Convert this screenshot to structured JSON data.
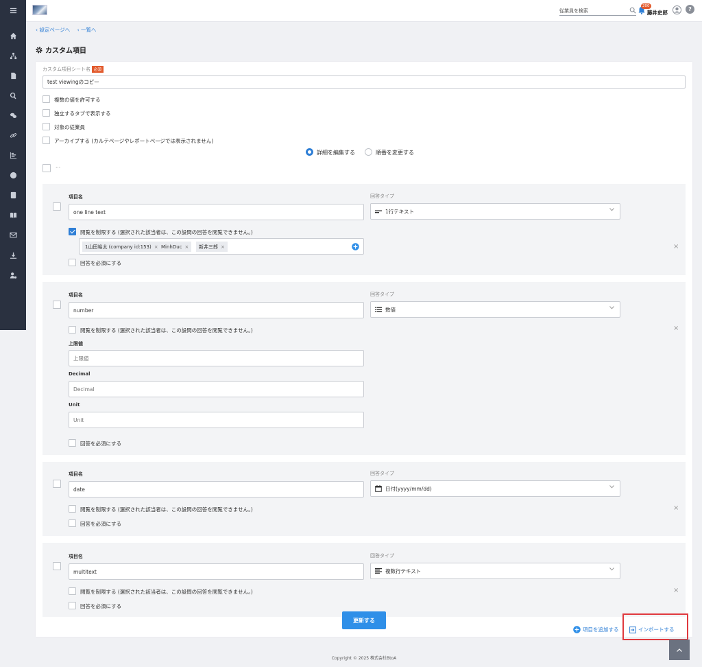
{
  "header": {
    "search_placeholder": "従業員を検索",
    "notification_count": "200",
    "user_name": "藤井史郎",
    "help_label": "?"
  },
  "breadcrumb": {
    "settings": "設定ページへ",
    "list": "一覧へ"
  },
  "page": {
    "title": "カスタム項目"
  },
  "sheet": {
    "name_label": "カスタム項目シート名",
    "required_badge": "必須",
    "name_value": "test viewingのコピー",
    "options": [
      {
        "label": "複数の値を許可する",
        "checked": false
      },
      {
        "label": "独立するタブで表示する",
        "checked": false
      },
      {
        "label": "対象の従業員",
        "checked": false
      },
      {
        "label": "アーカイブする (カルテページやレポートページでは表示されません)",
        "checked": false
      }
    ],
    "modes": [
      {
        "label": "詳細を編集する",
        "selected": true
      },
      {
        "label": "順番を変更する",
        "selected": false
      }
    ],
    "select_all_ellipsis": "···"
  },
  "common": {
    "item_name_label": "項目名",
    "answer_type_label": "回答タイプ",
    "restrict_label": "閲覧を制限する (選択された該当者は、この設問の回答を閲覧できません。)",
    "required_label": "回答を必須にする",
    "delete_symbol": "×",
    "tag_remove_symbol": "×"
  },
  "items": [
    {
      "name": "one line text",
      "type": "1行テキスト",
      "type_icon": "one-line-text-icon",
      "restrict_checked": true,
      "tags": [
        "1山田裕太 (company id:153)",
        "MinhDuc",
        "新井三郎"
      ]
    },
    {
      "name": "number",
      "type": "数値",
      "type_icon": "number-list-icon",
      "restrict_checked": false,
      "upper_label": "上限値",
      "upper_placeholder": "上限値",
      "decimal_label": "Decimal",
      "decimal_placeholder": "Decimal",
      "unit_label": "Unit",
      "unit_placeholder": "Unit"
    },
    {
      "name": "date",
      "type": "日付(yyyy/mm/dd)",
      "type_icon": "calendar-icon",
      "restrict_checked": false
    },
    {
      "name": "multitext",
      "type": "複数行テキスト",
      "type_icon": "multi-line-text-icon",
      "restrict_checked": false
    }
  ],
  "actions": {
    "update": "更新する",
    "add_item": "項目を追加する",
    "import": "インポートする"
  },
  "footer": {
    "copyright": "Copyright © 2025 株式会社BtoA"
  },
  "colors": {
    "accent": "#2f7fd6",
    "sidebar": "#2a3140",
    "badge": "#e25a2c",
    "highlight": "#e0393e"
  }
}
